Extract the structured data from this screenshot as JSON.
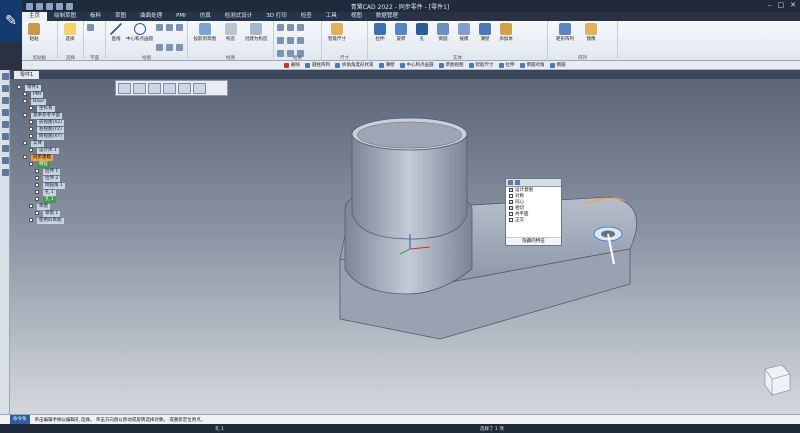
{
  "window": {
    "title": "青鹭CAD 2022 - 同步零件 - [零件1]"
  },
  "tabs": [
    "主页",
    "绘制草图",
    "板料",
    "草图",
    "曲面处理",
    "PMI",
    "仿真",
    "检测式设计",
    "3D 打印",
    "检查",
    "工具",
    "视图",
    "数据管理"
  ],
  "ribbon": {
    "groups": [
      {
        "label": "剪贴板",
        "items": [
          {
            "label": "粘贴",
            "icon": "paste-icon"
          }
        ]
      },
      {
        "label": "选择",
        "items": [
          {
            "label": "选择",
            "icon": "select-arrow-icon"
          }
        ]
      },
      {
        "label": "平面",
        "items": []
      },
      {
        "label": "绘图",
        "items": [
          {
            "label": "直线",
            "icon": "line-icon"
          },
          {
            "label": "中心和点画圆",
            "icon": "circle-icon"
          }
        ]
      },
      {
        "label": "绘图",
        "items": [
          {
            "label": "投影到草图",
            "icon": "project-icon"
          },
          {
            "label": "构造",
            "icon": "construct-icon"
          },
          {
            "label": "创建为构造",
            "icon": "create-construct-icon"
          }
        ]
      },
      {
        "label": "相关",
        "items": [
          {
            "label": "智能尺寸",
            "icon": "smart-dimension-icon"
          }
        ]
      },
      {
        "label": "尺寸",
        "items": []
      },
      {
        "label": "实体",
        "items": [
          {
            "label": "拉伸",
            "icon": "extrude-icon"
          },
          {
            "label": "旋转",
            "icon": "revolve-icon"
          },
          {
            "label": "孔",
            "icon": "hole-icon"
          },
          {
            "label": "倒圆",
            "icon": "round-icon"
          },
          {
            "label": "拔模",
            "icon": "draft-icon"
          },
          {
            "label": "薄壁",
            "icon": "thinwall-icon"
          },
          {
            "label": "添加体",
            "icon": "add-body-icon"
          }
        ]
      },
      {
        "label": "阵列",
        "items": [
          {
            "label": "矩形阵列",
            "icon": "rect-pattern-icon"
          },
          {
            "label": "镜像",
            "icon": "mirror-icon"
          }
        ]
      }
    ]
  },
  "commandbar": [
    "删除",
    "圆柱阵列",
    "拆角角度形状束",
    "薄壁",
    "中心和点画圆",
    "草图视图",
    "智能尺寸",
    "拉伸",
    "倒圆对角",
    "倒圆"
  ],
  "doc_tab": "零件1",
  "tree": [
    {
      "label": "零件1",
      "level": 0,
      "style": "normal"
    },
    {
      "label": "PMI",
      "level": 1,
      "style": "normal"
    },
    {
      "label": "Base",
      "level": 1,
      "style": "normal"
    },
    {
      "label": "坐标系",
      "level": 2,
      "style": "normal"
    },
    {
      "label": "基本参考平面",
      "level": 1,
      "style": "normal"
    },
    {
      "label": "前视图(XZ)",
      "level": 2,
      "style": "normal"
    },
    {
      "label": "右视图(YZ)",
      "level": 2,
      "style": "normal"
    },
    {
      "label": "俯视图(XY)",
      "level": 2,
      "style": "normal"
    },
    {
      "label": "实体",
      "level": 1,
      "style": "normal"
    },
    {
      "label": "设计体 1",
      "level": 2,
      "style": "normal"
    },
    {
      "label": "同步建模",
      "level": 1,
      "style": "orange"
    },
    {
      "label": "特征",
      "level": 2,
      "style": "green"
    },
    {
      "label": "拉伸 1",
      "level": 3,
      "style": "normal"
    },
    {
      "label": "拉伸 2",
      "level": 3,
      "style": "normal"
    },
    {
      "label": "倒圆角 1",
      "level": 3,
      "style": "normal"
    },
    {
      "label": "孔 1",
      "level": 3,
      "style": "normal"
    },
    {
      "label": "孔 1",
      "level": 3,
      "style": "green"
    },
    {
      "label": "草图",
      "level": 2,
      "style": "normal"
    },
    {
      "label": "草图 1",
      "level": 3,
      "style": "normal"
    },
    {
      "label": "使用的草图",
      "level": 2,
      "style": "normal"
    }
  ],
  "popup": {
    "items": [
      {
        "label": "设计意图",
        "checked": true
      },
      {
        "label": "对称",
        "checked": false
      },
      {
        "label": "同心",
        "checked": true
      },
      {
        "label": "相切",
        "checked": true
      },
      {
        "label": "共平面",
        "checked": false
      },
      {
        "label": "正交",
        "checked": false
      }
    ],
    "footer": "隐藏的特征"
  },
  "status": {
    "label": "命令条",
    "message": "单击编辑手柄以编辑孔 选择。 单击方向盘以移动或旋转选择对象。 或重新定位原点。"
  },
  "bottom": {
    "center": "孔 1",
    "selection": "选择了 1 项"
  },
  "colors": {
    "accent": "#2f5e9f",
    "model": "#a6aebe"
  }
}
